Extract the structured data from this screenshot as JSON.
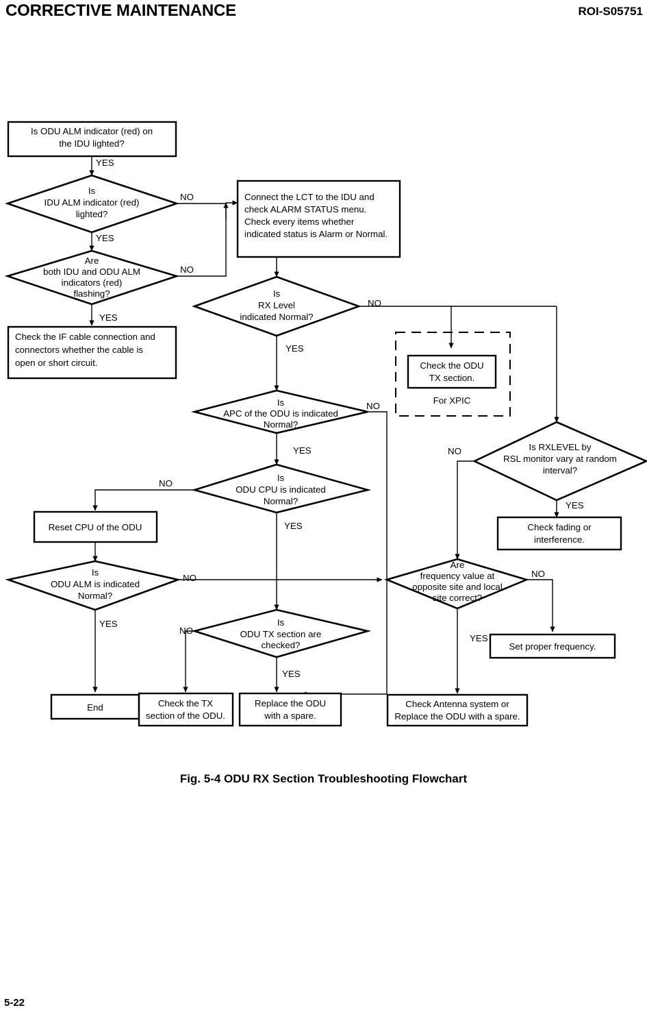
{
  "header": {
    "left_title": "CORRECTIVE MAINTENANCE",
    "right_code": "ROI-S05751"
  },
  "caption": "Fig. 5-4  ODU RX Section Troubleshooting Flowchart",
  "footer": {
    "page_number": "5-22"
  },
  "flowchart": {
    "title": "ODU RX Section Troubleshooting Flowchart",
    "nodes": {
      "start": {
        "type": "process",
        "lines": [
          "Is ODU ALM indicator (red) on",
          "the IDU lighted?"
        ]
      },
      "idu_alm": {
        "type": "decision",
        "lines": [
          "Is",
          "IDU ALM indicator (red)",
          "lighted?"
        ]
      },
      "both_alm": {
        "type": "decision",
        "lines": [
          "Are",
          "both IDU and ODU ALM",
          "indicators (red)",
          "flashing?"
        ]
      },
      "check_if_cable": {
        "type": "process",
        "lines": [
          "Check the IF cable connection and",
          "connectors whether the cable is",
          "open or short circuit."
        ]
      },
      "connect_lct": {
        "type": "process",
        "lines": [
          "Connect the LCT to the IDU and",
          "check ALARM STATUS menu.",
          "Check every items whether",
          "indicated status is Alarm or Normal."
        ]
      },
      "rx_level": {
        "type": "decision",
        "lines": [
          "Is",
          "RX Level",
          "indicated Normal?"
        ]
      },
      "check_odu_tx": {
        "type": "process",
        "lines": [
          "Check the ODU",
          "TX section."
        ]
      },
      "xpic_label": {
        "type": "annotation",
        "lines": [
          "For XPIC"
        ]
      },
      "apc_odu": {
        "type": "decision",
        "lines": [
          "Is",
          "APC of the ODU is indicated",
          "Normal?"
        ]
      },
      "odu_cpu": {
        "type": "decision",
        "lines": [
          "Is",
          "ODU CPU is indicated",
          "Normal?"
        ]
      },
      "reset_cpu": {
        "type": "process",
        "lines": [
          "Reset CPU of the ODU"
        ]
      },
      "odu_alm_norm": {
        "type": "decision",
        "lines": [
          "Is",
          "ODU ALM is indicated",
          "Normal?"
        ]
      },
      "odu_tx_checked": {
        "type": "decision",
        "lines": [
          "Is",
          "ODU TX section are",
          "checked?"
        ]
      },
      "rxlevel_rsl": {
        "type": "decision",
        "lines": [
          "Is RXLEVEL by",
          "RSL monitor vary at random",
          "interval?"
        ]
      },
      "check_fading": {
        "type": "process",
        "lines": [
          "Check fading or",
          "interference."
        ]
      },
      "freq_value": {
        "type": "decision",
        "lines": [
          "Are",
          "frequency value at",
          "opposite site and local",
          "site correct?"
        ]
      },
      "set_frequency": {
        "type": "process",
        "lines": [
          "Set proper frequency."
        ]
      },
      "end": {
        "type": "terminal",
        "lines": [
          "End"
        ]
      },
      "check_tx_section": {
        "type": "process",
        "lines": [
          "Check the TX",
          "section of the ODU."
        ]
      },
      "replace_odu": {
        "type": "process",
        "lines": [
          "Replace the ODU",
          "with a spare."
        ]
      },
      "check_antenna": {
        "type": "process",
        "lines": [
          "Check Antenna system or",
          "Replace the ODU with a spare."
        ]
      }
    },
    "edge_labels": {
      "start_yes": "YES",
      "idu_alm_yes": "YES",
      "idu_alm_no": "NO",
      "both_alm_yes": "YES",
      "both_alm_no": "NO",
      "rx_level_yes": "YES",
      "rx_level_no": "NO",
      "apc_yes": "YES",
      "apc_no": "NO",
      "odu_cpu_yes": "YES",
      "odu_cpu_no": "NO",
      "odu_alm_yes": "YES",
      "odu_alm_no": "NO",
      "odu_tx_yes": "YES",
      "odu_tx_no": "NO",
      "rxlevel_yes": "YES",
      "rxlevel_no": "NO",
      "freq_yes": "YES",
      "freq_no": "NO"
    }
  }
}
